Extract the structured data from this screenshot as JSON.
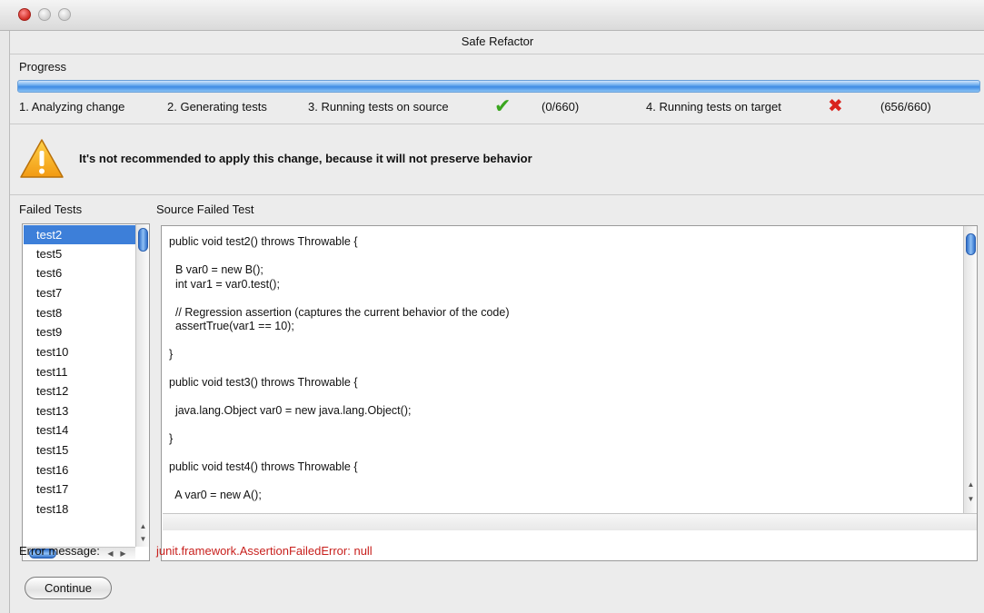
{
  "window": {
    "title": "Safe Refactor"
  },
  "progress": {
    "label": "Progress",
    "steps": [
      {
        "label": "1. Analyzing change"
      },
      {
        "label": "2. Generating tests"
      },
      {
        "label": "3. Running tests on source",
        "status": "pass",
        "count": "(0/660)"
      },
      {
        "label": "4. Running tests on target",
        "status": "fail",
        "count": "(656/660)"
      }
    ]
  },
  "warning": {
    "icon": "warning-icon",
    "message": "It's not recommended to apply this change, because it will not preserve behavior"
  },
  "failed_tests": {
    "label": "Failed Tests",
    "selected": "test2",
    "items": [
      "test2",
      "test5",
      "test6",
      "test7",
      "test8",
      "test9",
      "test10",
      "test11",
      "test12",
      "test13",
      "test14",
      "test15",
      "test16",
      "test17",
      "test18"
    ]
  },
  "source": {
    "label": "Source Failed Test",
    "code": "public void test2() throws Throwable {\n\n  B var0 = new B();\n  int var1 = var0.test();\n\n  // Regression assertion (captures the current behavior of the code)\n  assertTrue(var1 == 10);\n\n}\n\npublic void test3() throws Throwable {\n\n  java.lang.Object var0 = new java.lang.Object();\n\n}\n\npublic void test4() throws Throwable {\n\n  A var0 = new A();"
  },
  "error": {
    "label": "Error message:",
    "value": "junit.framework.AssertionFailedError: null"
  },
  "actions": {
    "continue_label": "Continue"
  },
  "colors": {
    "accent": "#3d7fd9",
    "error": "#c8201d",
    "success": "#3aa61f",
    "failure": "#d9231d"
  }
}
